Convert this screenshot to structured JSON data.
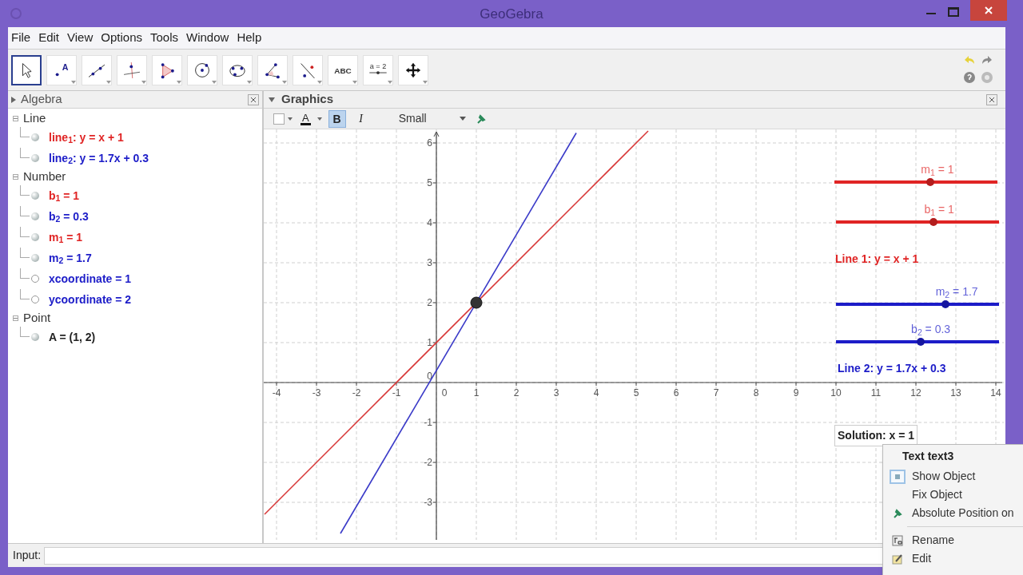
{
  "window": {
    "title": "GeoGebra"
  },
  "menu": [
    "File",
    "Edit",
    "View",
    "Options",
    "Tools",
    "Window",
    "Help"
  ],
  "toolbar": [
    {
      "kind": "move",
      "selected": true
    },
    {
      "kind": "point",
      "label": "A",
      "selected": false
    },
    {
      "kind": "line",
      "selected": false
    },
    {
      "kind": "perpendicular",
      "selected": false
    },
    {
      "kind": "polygon",
      "selected": false
    },
    {
      "kind": "circle",
      "selected": false
    },
    {
      "kind": "conic",
      "selected": false
    },
    {
      "kind": "angle",
      "selected": false
    },
    {
      "kind": "reflect",
      "selected": false
    },
    {
      "kind": "text",
      "label": "ABC",
      "selected": false
    },
    {
      "kind": "slider",
      "label": "a = 2",
      "selected": false
    },
    {
      "kind": "move_view",
      "selected": false
    }
  ],
  "algebra": {
    "title": "Algebra",
    "groups": [
      {
        "name": "Line",
        "children": [
          {
            "text": "line$_{1}$: y = x + 1",
            "color": "#e02424",
            "visible": true
          },
          {
            "text": "line$_{2}$: y = 1.7x + 0.3",
            "color": "#1c1cc8",
            "visible": true
          }
        ]
      },
      {
        "name": "Number",
        "children": [
          {
            "text": "b$_{1}$ = 1",
            "color": "#e02424",
            "visible": true
          },
          {
            "text": "b$_{2}$ = 0.3",
            "color": "#1c1cc8",
            "visible": true
          },
          {
            "text": "m$_{1}$ = 1",
            "color": "#e02424",
            "visible": true
          },
          {
            "text": "m$_{2}$ = 1.7",
            "color": "#1c1cc8",
            "visible": true
          },
          {
            "text": "xcoordinate = 1",
            "color": "#1c1cc8",
            "visible": false
          },
          {
            "text": "ycoordinate = 2",
            "color": "#1c1cc8",
            "visible": false
          }
        ]
      },
      {
        "name": "Point",
        "children": [
          {
            "text": "A = (1, 2)",
            "color": "#222222",
            "visible": true
          }
        ]
      }
    ]
  },
  "graphics": {
    "title": "Graphics",
    "style_bar": {
      "text_color_label": "A",
      "bold": {
        "label": "B",
        "selected": true
      },
      "italic": {
        "label": "I",
        "selected": false
      },
      "size": "Small"
    },
    "chart_data": {
      "type": "line",
      "x": [
        -4.3,
        -2.4,
        3.5,
        5.3
      ],
      "series": [
        {
          "color": "#d83a3a",
          "values": [
            -3.3,
            -1.4,
            4.5,
            6.3
          ]
        },
        {
          "color": "#3a3ac8",
          "values": [
            null,
            -3.78,
            6.25,
            null
          ]
        }
      ],
      "xlim": [
        -4.32,
        14.2
      ],
      "ylim": [
        -3.94,
        6.34
      ],
      "xticks": [
        -4,
        -3,
        -2,
        -1,
        1,
        2,
        3,
        4,
        5,
        6,
        7,
        8,
        9,
        10,
        11,
        12,
        13,
        14
      ],
      "yticks": [
        -3,
        -2,
        -1,
        1,
        2,
        3,
        4,
        5,
        6
      ],
      "grid": true
    },
    "origin_labels": [
      "0",
      "0"
    ],
    "sliders": [
      {
        "label": "m$_{1}$ = 1",
        "color": "#e02424",
        "level": 0.59
      },
      {
        "label": "b$_{1}$ = 1",
        "color": "#e02424",
        "level": 0.6
      },
      {
        "label": "m$_{2}$ = 1.7",
        "color": "#1c1cc8",
        "level": 0.67
      },
      {
        "label": "b$_{2}$ = 0.3",
        "color": "#1c1cc8",
        "level": 0.52
      }
    ],
    "texts": [
      {
        "text": "Line 1: y = x + 1",
        "color": "#e02424"
      },
      {
        "text": "Line 2: y = 1.7x + 0.3",
        "color": "#1c1cc8"
      }
    ],
    "solution": "Solution: x = 1"
  },
  "input": {
    "label": "Input:"
  },
  "context_menu": {
    "title": "Text text3",
    "items": [
      {
        "kind": "check",
        "label": "Show Object"
      },
      {
        "kind": "plain",
        "label": "Fix Object"
      },
      {
        "kind": "pin",
        "label": "Absolute Position on"
      },
      {
        "kind": "separator"
      },
      {
        "kind": "rename",
        "label": "Rename"
      },
      {
        "kind": "edit",
        "label": "Edit"
      }
    ]
  }
}
